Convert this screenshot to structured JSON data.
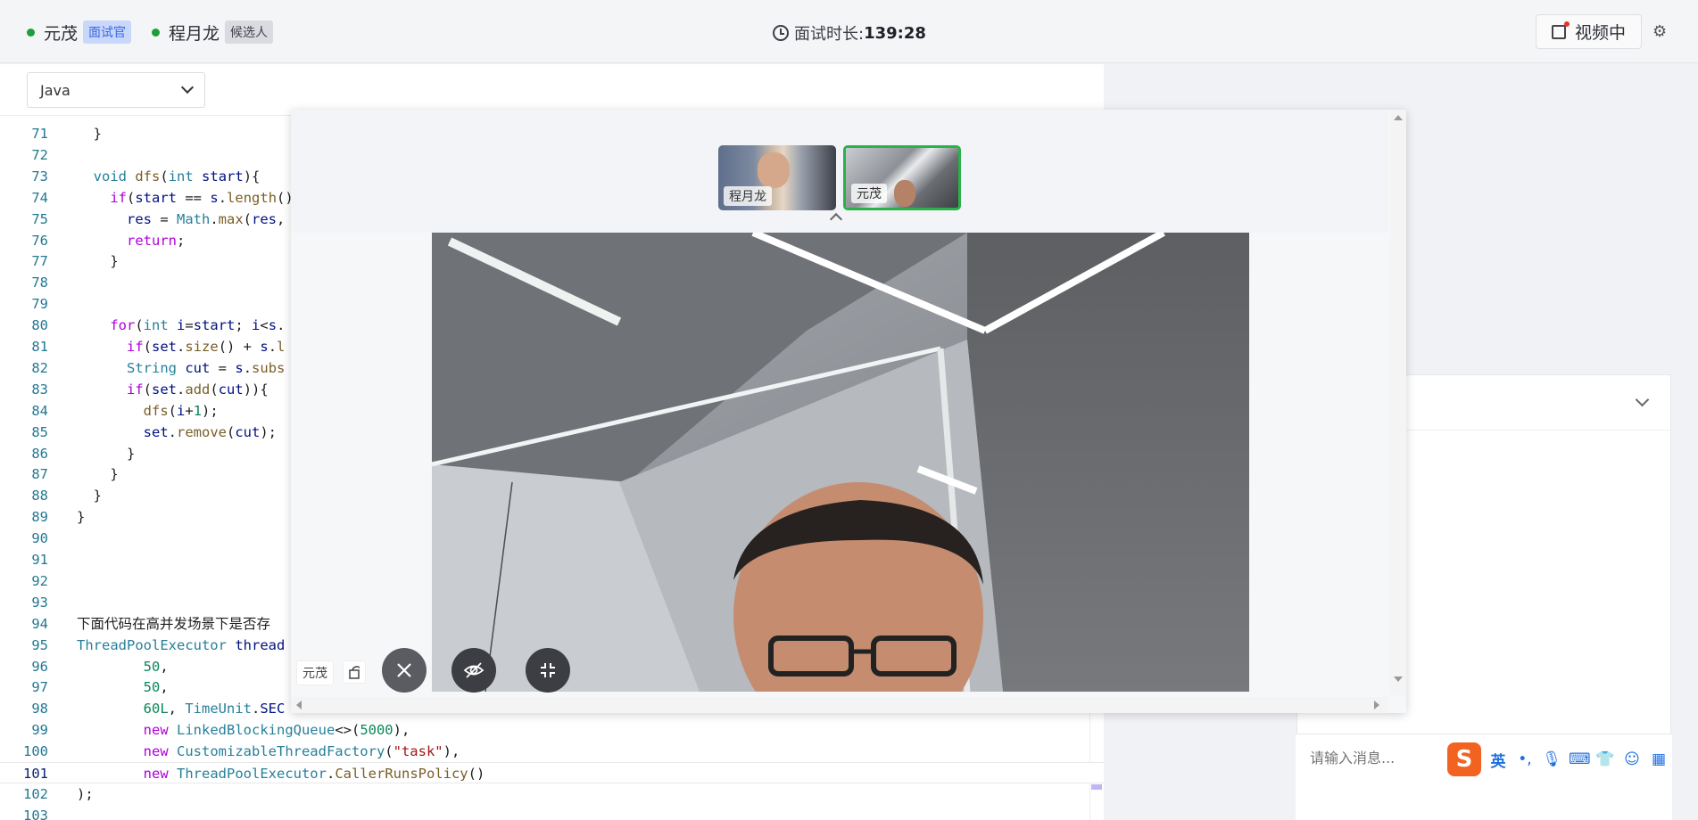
{
  "header": {
    "participants": [
      {
        "name": "元茂",
        "role": "面试官"
      },
      {
        "name": "程月龙",
        "role": "候选人"
      }
    ],
    "timer_label": "面试时长:",
    "timer_value": "139:28",
    "video_button_label": "视频中"
  },
  "editor": {
    "language": "Java",
    "lines": [
      {
        "n": "71",
        "html": "  }"
      },
      {
        "n": "72",
        "html": ""
      },
      {
        "n": "73",
        "html": "  <span class=\"ty\">void</span> <span class=\"fn\">dfs</span>(<span class=\"ty\">int</span> <span class=\"vr\">start</span>){"
      },
      {
        "n": "74",
        "html": "    <span class=\"kw\">if</span>(<span class=\"vr\">start</span> == <span class=\"vr\">s</span>.<span class=\"fn\">length</span>()"
      },
      {
        "n": "75",
        "html": "      <span class=\"vr\">res</span> = <span class=\"ty\">Math</span>.<span class=\"fn\">max</span>(<span class=\"vr\">res</span>,"
      },
      {
        "n": "76",
        "html": "      <span class=\"kw\">return</span>;"
      },
      {
        "n": "77",
        "html": "    }"
      },
      {
        "n": "78",
        "html": ""
      },
      {
        "n": "79",
        "html": ""
      },
      {
        "n": "80",
        "html": "    <span class=\"kw\">for</span>(<span class=\"ty\">int</span> <span class=\"vr\">i</span>=<span class=\"vr\">start</span>; <span class=\"vr\">i</span>&lt;<span class=\"vr\">s</span>."
      },
      {
        "n": "81",
        "html": "      <span class=\"kw\">if</span>(<span class=\"vr\">set</span>.<span class=\"fn\">size</span>() + <span class=\"vr\">s</span>.<span class=\"fn\">l</span>"
      },
      {
        "n": "82",
        "html": "      <span class=\"ty\">String</span> <span class=\"vr\">cut</span> = <span class=\"vr\">s</span>.<span class=\"fn\">subs</span>"
      },
      {
        "n": "83",
        "html": "      <span class=\"kw\">if</span>(<span class=\"vr\">set</span>.<span class=\"fn\">add</span>(<span class=\"vr\">cut</span>)){"
      },
      {
        "n": "84",
        "html": "        <span class=\"fn\">dfs</span>(<span class=\"vr\">i</span>+<span class=\"nm\">1</span>);"
      },
      {
        "n": "85",
        "html": "        <span class=\"vr\">set</span>.<span class=\"fn\">remove</span>(<span class=\"vr\">cut</span>);"
      },
      {
        "n": "86",
        "html": "      }"
      },
      {
        "n": "87",
        "html": "    }"
      },
      {
        "n": "88",
        "html": "  }"
      },
      {
        "n": "89",
        "html": "}"
      },
      {
        "n": "90",
        "html": ""
      },
      {
        "n": "91",
        "html": ""
      },
      {
        "n": "92",
        "html": ""
      },
      {
        "n": "93",
        "html": ""
      },
      {
        "n": "94",
        "html": "下面代码在高并发场景下是否存"
      },
      {
        "n": "95",
        "html": "<span class=\"ty\">ThreadPoolExecutor</span> <span class=\"vr\">thread</span>"
      },
      {
        "n": "96",
        "html": "        <span class=\"nm\">50</span>,"
      },
      {
        "n": "97",
        "html": "        <span class=\"nm\">50</span>,"
      },
      {
        "n": "98",
        "html": "        <span class=\"nm\">60L</span>, <span class=\"ty\">TimeUnit</span>.<span class=\"vr\">SEC</span>"
      },
      {
        "n": "99",
        "html": "        <span class=\"kw\">new</span> <span class=\"ty\">LinkedBlockingQueue</span>&lt;&gt;(<span class=\"nm\">5000</span>),"
      },
      {
        "n": "100",
        "html": "        <span class=\"kw\">new</span> <span class=\"ty\">CustomizableThreadFactory</span>(<span class=\"st\">\"task\"</span>),"
      },
      {
        "n": "101",
        "html": "        <span class=\"kw\">new</span> <span class=\"ty\">ThreadPoolExecutor</span>.<span class=\"fn\">CallerRunsPolicy</span>()"
      },
      {
        "n": "102",
        "html": ");"
      },
      {
        "n": "103",
        "html": ""
      }
    ],
    "current_line": "101"
  },
  "video": {
    "thumbnails": [
      {
        "label": "程月龙"
      },
      {
        "label": "元茂"
      }
    ],
    "active_speaker": "元茂"
  },
  "chat": {
    "placeholder": "请输入消息..."
  },
  "ime": {
    "mode": "英",
    "logo": "S"
  },
  "colors": {
    "online": "#1e9e3a",
    "interviewer_badge": "#c9d7fb",
    "active_thumb": "#2ab24a"
  }
}
